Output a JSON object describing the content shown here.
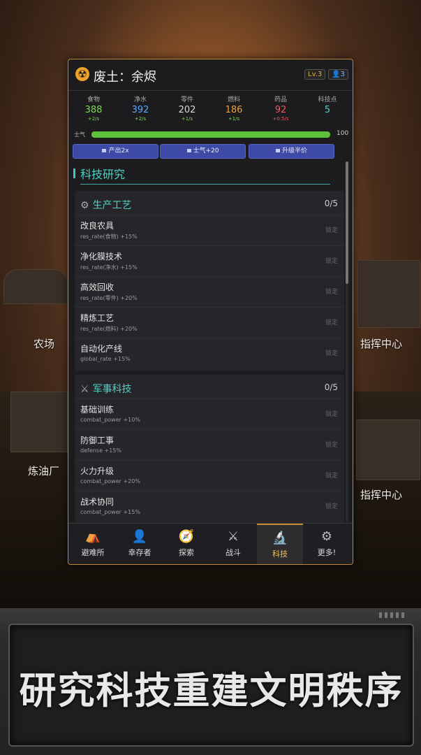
{
  "map": {
    "labels": [
      "农场",
      "指挥中心",
      "炼油厂",
      "指挥中心"
    ]
  },
  "header": {
    "icon": "radiation-icon",
    "title": "废土：余烬",
    "level": "Lv.3",
    "population": "3"
  },
  "resources": [
    {
      "name": "食物",
      "value": "388",
      "rate": "+2/s",
      "color": "#7ed957",
      "rate_color": "#7ed957"
    },
    {
      "name": "净水",
      "value": "392",
      "rate": "+2/s",
      "color": "#5aa8ff",
      "rate_color": "#7ed957"
    },
    {
      "name": "零件",
      "value": "202",
      "rate": "+1/s",
      "color": "#d8d8d8",
      "rate_color": "#7ed957"
    },
    {
      "name": "燃料",
      "value": "186",
      "rate": "+1/s",
      "color": "#f0a23c",
      "rate_color": "#7ed957"
    },
    {
      "name": "药品",
      "value": "92",
      "rate": "+0.5/s",
      "color": "#f05a5a",
      "rate_color": "#f05a5a"
    },
    {
      "name": "科技点",
      "value": "5",
      "rate": "",
      "color": "#4fd1c5",
      "rate_color": "#7ed957"
    }
  ],
  "morale": {
    "label": "士气",
    "value": "100",
    "fraction": 1.0
  },
  "buffs": [
    "产出2x",
    "士气+20",
    "升级半价"
  ],
  "section_title": "科技研究",
  "categories": [
    {
      "icon": "gear-icon",
      "name": "生产工艺",
      "count": "0/5",
      "techs": [
        {
          "name": "改良农具",
          "desc": "res_rate(食物) +15%",
          "status": "锁定"
        },
        {
          "name": "净化膜技术",
          "desc": "res_rate(净水) +15%",
          "status": "锁定"
        },
        {
          "name": "高效回收",
          "desc": "res_rate(零件) +20%",
          "status": "锁定"
        },
        {
          "name": "精炼工艺",
          "desc": "res_rate(燃料) +20%",
          "status": "锁定"
        },
        {
          "name": "自动化产线",
          "desc": "global_rate +15%",
          "status": "锁定"
        }
      ]
    },
    {
      "icon": "crossed-swords-icon",
      "name": "军事科技",
      "count": "0/5",
      "techs": [
        {
          "name": "基础训练",
          "desc": "combat_power +10%",
          "status": "锁定"
        },
        {
          "name": "防御工事",
          "desc": "defense +15%",
          "status": "锁定"
        },
        {
          "name": "火力升级",
          "desc": "combat_power +20%",
          "status": "锁定"
        },
        {
          "name": "战术协同",
          "desc": "combat_power +15%",
          "status": "锁定"
        }
      ]
    }
  ],
  "nav": [
    {
      "label": "避难所",
      "icon": "shelter-icon"
    },
    {
      "label": "幸存者",
      "icon": "person-icon"
    },
    {
      "label": "探索",
      "icon": "compass-icon"
    },
    {
      "label": "战斗",
      "icon": "crossed-swords-icon"
    },
    {
      "label": "科技",
      "icon": "microscope-icon",
      "active": true
    },
    {
      "label": "更多!",
      "icon": "gear-icon"
    }
  ],
  "banner": {
    "text": "研究科技重建文明秩序"
  }
}
